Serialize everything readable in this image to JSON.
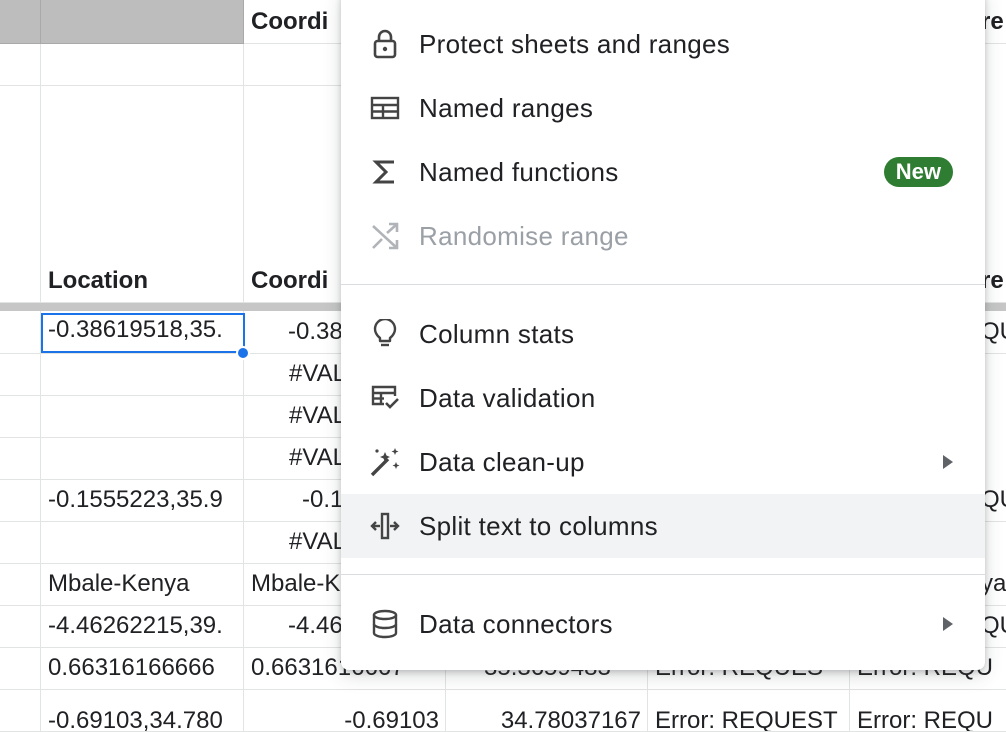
{
  "sheet": {
    "header_row": {
      "col_c": "Coordi",
      "col_far_right": "re"
    },
    "subheader_row": {
      "col_b": "Location",
      "col_c": "Coordi",
      "col_far_right": "re"
    },
    "rows": [
      {
        "b": "-0.38619518,35.",
        "c": "-0.38",
        "right": "QU"
      },
      {
        "b": "",
        "c": "#VAL",
        "right": ""
      },
      {
        "b": "",
        "c": "#VAL",
        "right": ""
      },
      {
        "b": "",
        "c": "#VAL",
        "right": ""
      },
      {
        "b": "-0.1555223,35.9",
        "c": "-0.1",
        "right": "QU"
      },
      {
        "b": "",
        "c": "#VAL",
        "right": ""
      },
      {
        "b": "Mbale-Kenya",
        "c": "Mbale-K",
        "right": "ya"
      },
      {
        "b": "-4.46262215,39.",
        "c": "-4.46",
        "right": "QU"
      },
      {
        "b": "0.66316166666",
        "c": "0.6631616667",
        "d": "35.3659483",
        "e": "Error: REQUES",
        "f": "Error: REQU"
      },
      {
        "b": "-0.69103,34.780",
        "c": "-0.69103",
        "d": "34.78037167",
        "e": "Error: REQUEST",
        "f": "Error: REQU"
      }
    ]
  },
  "menu": {
    "items": [
      {
        "label": "Protect sheets and ranges",
        "icon": "lock-icon"
      },
      {
        "label": "Named ranges",
        "icon": "table-icon"
      },
      {
        "label": "Named functions",
        "icon": "sigma-icon",
        "badge": "New"
      },
      {
        "label": "Randomise range",
        "icon": "shuffle-icon",
        "disabled": true
      },
      {
        "label": "Column stats",
        "icon": "lightbulb-icon"
      },
      {
        "label": "Data validation",
        "icon": "data-validation-icon"
      },
      {
        "label": "Data clean-up",
        "icon": "magic-wand-icon",
        "submenu": true
      },
      {
        "label": "Split text to columns",
        "icon": "split-columns-icon",
        "hover": true
      },
      {
        "label": "Data connectors",
        "icon": "database-icon",
        "submenu": true
      }
    ]
  },
  "colors": {
    "accent": "#1a73e8",
    "badge": "#2e7d32",
    "header_gray": "#bdbdbd"
  }
}
